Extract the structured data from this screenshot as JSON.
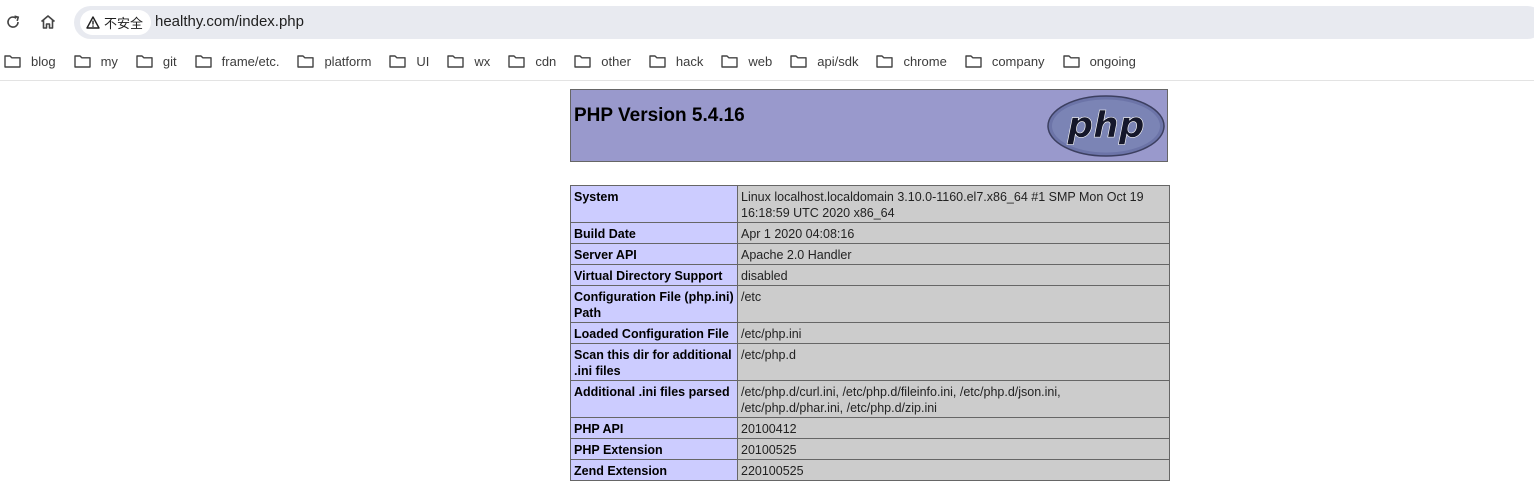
{
  "browser": {
    "security_label": "不安全",
    "url": "healthy.com/index.php",
    "bookmarks": [
      {
        "label": "blog"
      },
      {
        "label": "my"
      },
      {
        "label": "git"
      },
      {
        "label": "frame/etc."
      },
      {
        "label": "platform"
      },
      {
        "label": "UI"
      },
      {
        "label": "wx"
      },
      {
        "label": "cdn"
      },
      {
        "label": "other"
      },
      {
        "label": "hack"
      },
      {
        "label": "web"
      },
      {
        "label": "api/sdk"
      },
      {
        "label": "chrome"
      },
      {
        "label": "company"
      },
      {
        "label": "ongoing"
      }
    ]
  },
  "phpinfo": {
    "version_title": "PHP Version 5.4.16",
    "logo_text": "php",
    "rows": [
      {
        "key": "System",
        "value": "Linux localhost.localdomain 3.10.0-1160.el7.x86_64 #1 SMP Mon Oct 19 16:18:59 UTC 2020 x86_64"
      },
      {
        "key": "Build Date",
        "value": "Apr 1 2020 04:08:16"
      },
      {
        "key": "Server API",
        "value": "Apache 2.0 Handler"
      },
      {
        "key": "Virtual Directory Support",
        "value": "disabled"
      },
      {
        "key": "Configuration File (php.ini) Path",
        "value": "/etc"
      },
      {
        "key": "Loaded Configuration File",
        "value": "/etc/php.ini"
      },
      {
        "key": "Scan this dir for additional .ini files",
        "value": "/etc/php.d"
      },
      {
        "key": "Additional .ini files parsed",
        "value": "/etc/php.d/curl.ini, /etc/php.d/fileinfo.ini, /etc/php.d/json.ini, /etc/php.d/phar.ini, /etc/php.d/zip.ini"
      },
      {
        "key": "PHP API",
        "value": "20100412"
      },
      {
        "key": "PHP Extension",
        "value": "20100525"
      },
      {
        "key": "Zend Extension",
        "value": "220100525"
      }
    ]
  },
  "colors": {
    "header_bg": "#9999cc",
    "key_cell_bg": "#ccccff",
    "value_cell_bg": "#cccccc",
    "omnibox_bg": "#e8eaf0"
  }
}
